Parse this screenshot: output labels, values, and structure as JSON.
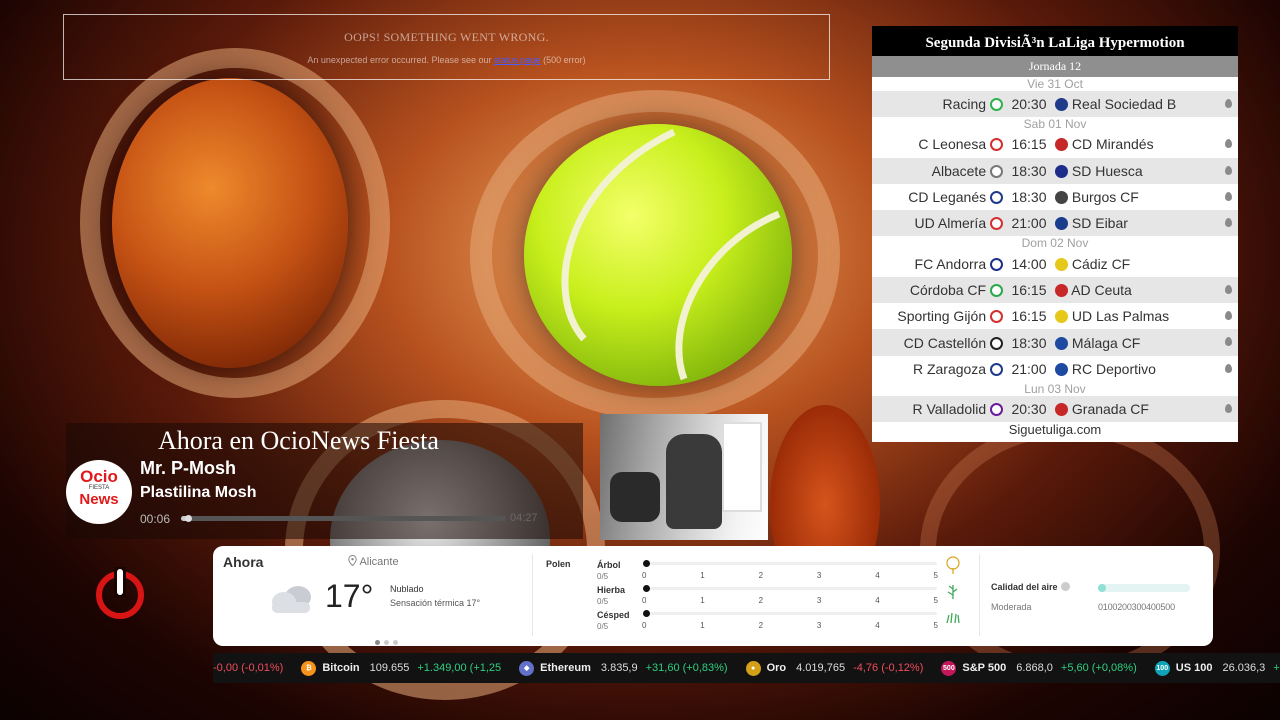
{
  "error": {
    "title": "OOPS! SOMETHING WENT WRONG.",
    "message_pre": "An unexpected error occurred. Please see our",
    "link": "status page",
    "message_post": "(500 error)"
  },
  "league": {
    "title": "Segunda DivisiÃ³n LaLiga Hypermotion",
    "round": "Jornada 12",
    "footer": "Siguetuliga.com",
    "days": [
      {
        "label": "Vie 31 Oct",
        "matches": [
          {
            "home": "Racing",
            "time": "20:30",
            "away": "Real Sociedad B",
            "home_color": "#2db34a",
            "away_color": "#1f3a8a",
            "pin": true
          }
        ]
      },
      {
        "label": "Sab 01 Nov",
        "matches": [
          {
            "home": "C Leonesa",
            "time": "16:15",
            "away": "CD Mirandés",
            "home_color": "#d32f2f",
            "away_color": "#c62828",
            "pin": true
          },
          {
            "home": "Albacete",
            "time": "18:30",
            "away": "SD Huesca",
            "home_color": "#777777",
            "away_color": "#1c2d8a",
            "pin": true
          },
          {
            "home": "CD Leganés",
            "time": "18:30",
            "away": "Burgos CF",
            "home_color": "#1e3a8a",
            "away_color": "#444444",
            "pin": true
          },
          {
            "home": "UD Almería",
            "time": "21:00",
            "away": "SD Eibar",
            "home_color": "#d32f2f",
            "away_color": "#1a3c8c",
            "pin": true
          }
        ]
      },
      {
        "label": "Dom 02 Nov",
        "matches": [
          {
            "home": "FC Andorra",
            "time": "14:00",
            "away": "Cádiz CF",
            "home_color": "#1d2f8a",
            "away_color": "#e6c81a",
            "pin": false
          },
          {
            "home": "Córdoba CF",
            "time": "16:15",
            "away": "AD Ceuta",
            "home_color": "#2aa84a",
            "away_color": "#c62828",
            "pin": true
          },
          {
            "home": "Sporting Gijón",
            "time": "16:15",
            "away": "UD Las Palmas",
            "home_color": "#d32f2f",
            "away_color": "#e6c81a",
            "pin": true
          },
          {
            "home": "CD Castellón",
            "time": "18:30",
            "away": "Málaga CF",
            "home_color": "#222222",
            "away_color": "#1e4aa0",
            "pin": true
          },
          {
            "home": "R Zaragoza",
            "time": "21:00",
            "away": "RC Deportivo",
            "home_color": "#1e3a8a",
            "away_color": "#1e4aa0",
            "pin": true
          }
        ]
      },
      {
        "label": "Lun 03 Nov",
        "matches": [
          {
            "home": "R Valladolid",
            "time": "20:30",
            "away": "Granada CF",
            "home_color": "#6a1b9a",
            "away_color": "#c62828",
            "pin": true
          }
        ]
      }
    ]
  },
  "now_playing": {
    "heading": "Ahora en OcioNews Fiesta",
    "logo": {
      "line1": "Ocio",
      "line2": "FIESTA",
      "line3": "News"
    },
    "artist": "Mr. P-Mosh",
    "song": "Plastilina Mosh",
    "elapsed": "00:06",
    "duration": "04:27",
    "progress": 0.02
  },
  "weather": {
    "title": "Ahora",
    "location": "Alicante",
    "temperature": "17°",
    "condition": "Nublado",
    "feels_like": "Sensación térmica 17°",
    "pollen_title": "Polen",
    "pollen": [
      {
        "name": "Árbol",
        "value": "0/5",
        "level": 0,
        "icon": "tree-icon"
      },
      {
        "name": "Hierba",
        "value": "0/5",
        "level": 0,
        "icon": "herb-icon"
      },
      {
        "name": "Césped",
        "value": "0/5",
        "level": 0,
        "icon": "grass-icon"
      }
    ],
    "scale": [
      "0",
      "1",
      "2",
      "3",
      "4",
      "5"
    ],
    "air_quality_label": "Calidad del aire",
    "air_quality_value": "Moderada",
    "air_quality_scale": "0100200300400500",
    "air_quality_level": 0
  },
  "ticker": [
    {
      "name": "",
      "price": "",
      "change": "-0,00 (-0,01%)",
      "dir": "down",
      "icon": "",
      "color": ""
    },
    {
      "name": "Bitcoin",
      "price": "109.655",
      "change": "+1.349,00 (+1,25",
      "dir": "up",
      "icon": "₿",
      "color": "#f7931a"
    },
    {
      "name": "Ethereum",
      "price": "3.835,9",
      "change": "+31,60 (+0,83%)",
      "dir": "up",
      "icon": "◆",
      "color": "#6270c8"
    },
    {
      "name": "Oro",
      "price": "4.019,765",
      "change": "-4,76 (-0,12%)",
      "dir": "down",
      "icon": "●",
      "color": "#d4a017"
    },
    {
      "name": "S&P 500",
      "price": "6.868,0",
      "change": "+5,60 (+0,08%)",
      "dir": "up",
      "icon": "500",
      "color": "#c2185b"
    },
    {
      "name": "US 100",
      "price": "26.036,3",
      "change": "+",
      "dir": "up",
      "icon": "100",
      "color": "#0fa4b8"
    }
  ]
}
